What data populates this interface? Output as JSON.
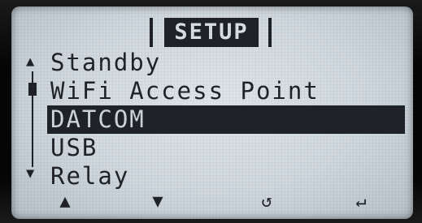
{
  "screen": {
    "title": "SETUP"
  },
  "menu": {
    "items": [
      {
        "label": "Standby",
        "selected": false
      },
      {
        "label": "WiFi Access Point",
        "selected": false
      },
      {
        "label": "DATCOM",
        "selected": true
      },
      {
        "label": "USB",
        "selected": false
      },
      {
        "label": "Relay",
        "selected": false
      }
    ]
  },
  "scrollbar": {
    "up_icon": "▲",
    "down_icon": "▼"
  },
  "softkeys": {
    "up_icon": "▲",
    "down_icon": "▼",
    "back_icon": "↺",
    "enter_icon": "↵"
  }
}
